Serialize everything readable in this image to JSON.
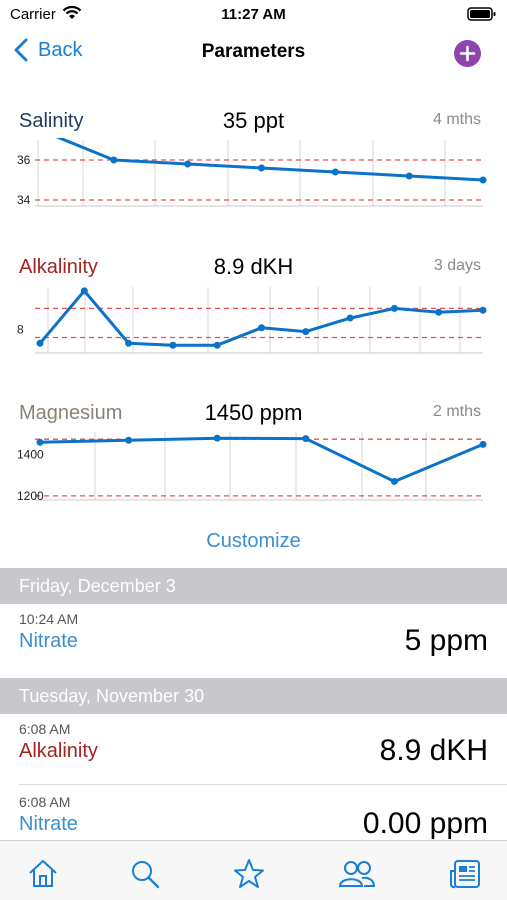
{
  "status_bar": {
    "carrier": "Carrier",
    "time": "11:27 AM"
  },
  "nav": {
    "back_label": "Back",
    "title": "Parameters"
  },
  "params": [
    {
      "name": "Salinity",
      "value": "35 ppt",
      "period": "4 mths",
      "name_color": "#1f3a5f",
      "chart": {
        "y_ticks": [
          "36",
          "34"
        ],
        "y_range": [
          33.7,
          37
        ],
        "thresholds": [
          36,
          34
        ],
        "points": [
          37.5,
          36.0,
          35.8,
          35.6,
          35.4,
          35.2,
          35.0
        ]
      }
    },
    {
      "name": "Alkalinity",
      "value": "8.9 dKH",
      "period": "3 days",
      "name_color": "#a32222",
      "chart": {
        "y_ticks": [
          "8"
        ],
        "y_range": [
          6.8,
          10.2
        ],
        "thresholds": [
          9.1,
          7.6
        ],
        "points": [
          7.3,
          10.0,
          7.3,
          7.2,
          7.2,
          8.1,
          7.9,
          8.6,
          9.1,
          8.9,
          9.0
        ]
      }
    },
    {
      "name": "Magnesium",
      "value": "1450 ppm",
      "period": "2 mths",
      "name_color": "#8a8278",
      "chart": {
        "y_ticks": [
          "1400",
          "1200"
        ],
        "y_range": [
          1180,
          1510
        ],
        "thresholds": [
          1475,
          1200
        ],
        "points": [
          1460,
          1470,
          1480,
          1478,
          1270,
          1450
        ]
      }
    }
  ],
  "customize_label": "Customize",
  "log": [
    {
      "date": "Friday, December 3",
      "entries": [
        {
          "time": "10:24 AM",
          "name": "Nitrate",
          "value": "5 ppm",
          "color": "#3b8fce"
        }
      ]
    },
    {
      "date": "Tuesday, November 30",
      "entries": [
        {
          "time": "6:08 AM",
          "name": "Alkalinity",
          "value": "8.9 dKH",
          "color": "#a32222"
        },
        {
          "time": "6:08 AM",
          "name": "Nitrate",
          "value": "0.00 ppm",
          "color": "#3b8fce"
        }
      ]
    }
  ],
  "tabs": [
    "home-icon",
    "search-icon",
    "star-icon",
    "community-icon",
    "news-icon"
  ],
  "colors": {
    "accent": "#1a7fd4",
    "line": "#0a72c8",
    "threshold": "#e8504f",
    "add_button": "#8e44ad"
  }
}
